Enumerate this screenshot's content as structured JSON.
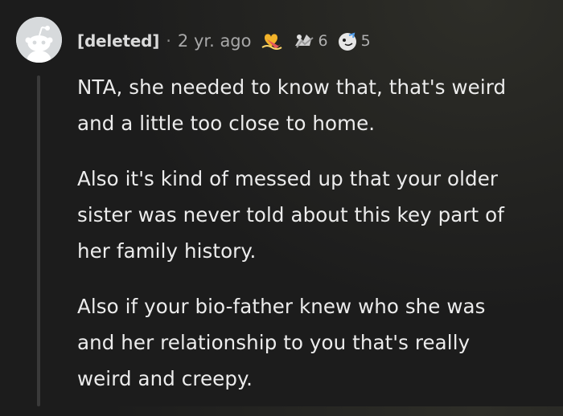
{
  "comment": {
    "author": "[deleted]",
    "separator": "·",
    "time": "2 yr. ago",
    "awards": [
      {
        "icon": "heart-award-icon",
        "count": ""
      },
      {
        "icon": "wholesome-seal-award-icon",
        "count": "6"
      },
      {
        "icon": "helpful-award-icon",
        "count": "5"
      }
    ],
    "paragraphs": [
      {
        "lines": [
          "NTA, she needed to know that, that's weird",
          "and a little too close to home."
        ]
      },
      {
        "lines": [
          "Also it's kind of messed up that your older",
          "sister was never told about this key part of",
          "her family history."
        ]
      },
      {
        "lines": [
          "Also if your bio-father knew who she was",
          "and her relationship to you that's really",
          "weird and creepy."
        ]
      }
    ]
  }
}
